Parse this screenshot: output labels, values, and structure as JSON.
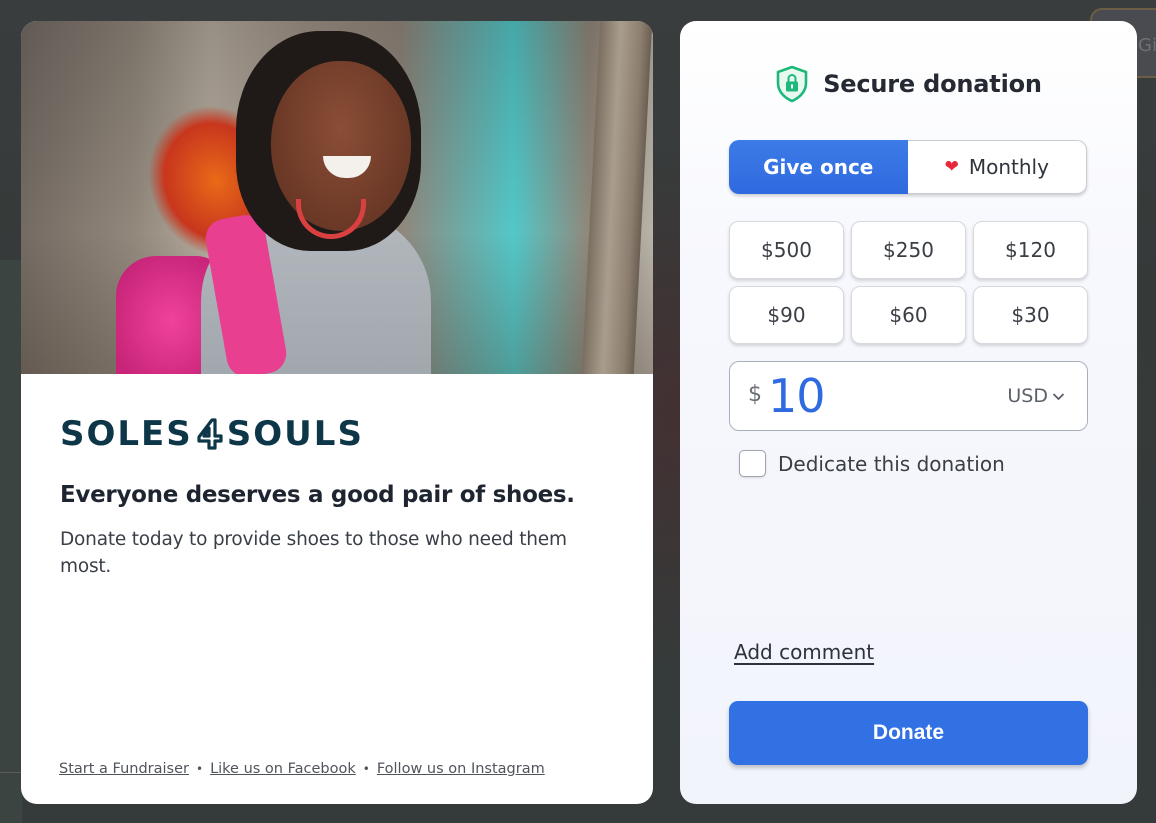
{
  "background": {
    "partial_button_label": "Giv"
  },
  "info_card": {
    "hero_image_alt": "Smiling girl with pink backpack and colorful head scarf",
    "logo": {
      "left": "SOLES",
      "right": "SOULS",
      "icon": "shoe-4-icon"
    },
    "tagline": "Everyone deserves a good pair of shoes.",
    "description": "Donate today to provide shoes to those who need them most.",
    "footer_links": [
      {
        "label": "Start a Fundraiser"
      },
      {
        "label": "Like us on Facebook"
      },
      {
        "label": "Follow us on Instagram"
      }
    ],
    "separator": "•"
  },
  "form": {
    "title": "Secure donation",
    "title_icon": "shield-lock-icon",
    "frequency": {
      "options": [
        {
          "label": "Give once",
          "selected": true
        },
        {
          "label": "Monthly",
          "selected": false,
          "icon": "heart-icon"
        }
      ]
    },
    "preset_amounts": [
      "$500",
      "$250",
      "$120",
      "$90",
      "$60",
      "$30"
    ],
    "amount": {
      "currency_symbol": "$",
      "value": "10",
      "currency": "USD"
    },
    "dedicate": {
      "label": "Dedicate this donation",
      "checked": false
    },
    "add_comment_label": "Add comment",
    "donate_label": "Donate"
  },
  "colors": {
    "primary": "#3171e3",
    "logo_navy": "#0d3648",
    "shield_green": "#1cb97a",
    "heart_red": "#e8283a"
  }
}
